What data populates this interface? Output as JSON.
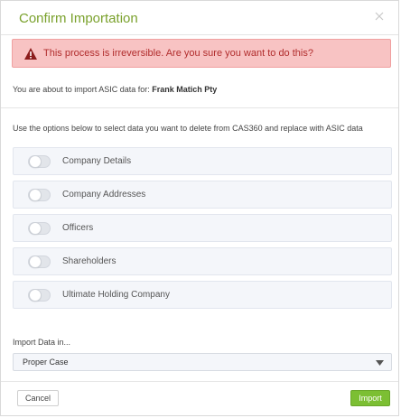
{
  "dialog": {
    "title": "Confirm Importation",
    "close_icon": "close-icon"
  },
  "alert": {
    "icon": "warning-icon",
    "text": "This process is irreversible. Are you sure you want to do this?",
    "colors": {
      "background": "#f8c3c3",
      "text": "#b12d2d"
    }
  },
  "import_line": {
    "prefix": "You are about to import ASIC data for:",
    "company": "Frank Matich Pty"
  },
  "options_text": "Use the options below to select data you want to delete from CAS360 and replace with ASIC data",
  "options": [
    {
      "label": "Company Details",
      "enabled": false
    },
    {
      "label": "Company Addresses",
      "enabled": false
    },
    {
      "label": "Officers",
      "enabled": false
    },
    {
      "label": "Shareholders",
      "enabled": false
    },
    {
      "label": "Ultimate Holding Company",
      "enabled": false
    }
  ],
  "import_in": {
    "label": "Import Data in...",
    "selected": "Proper Case"
  },
  "buttons": {
    "cancel": "Cancel",
    "import": "Import"
  },
  "colors": {
    "title": "#7aa12c",
    "primary_button": "#7cbf33"
  }
}
